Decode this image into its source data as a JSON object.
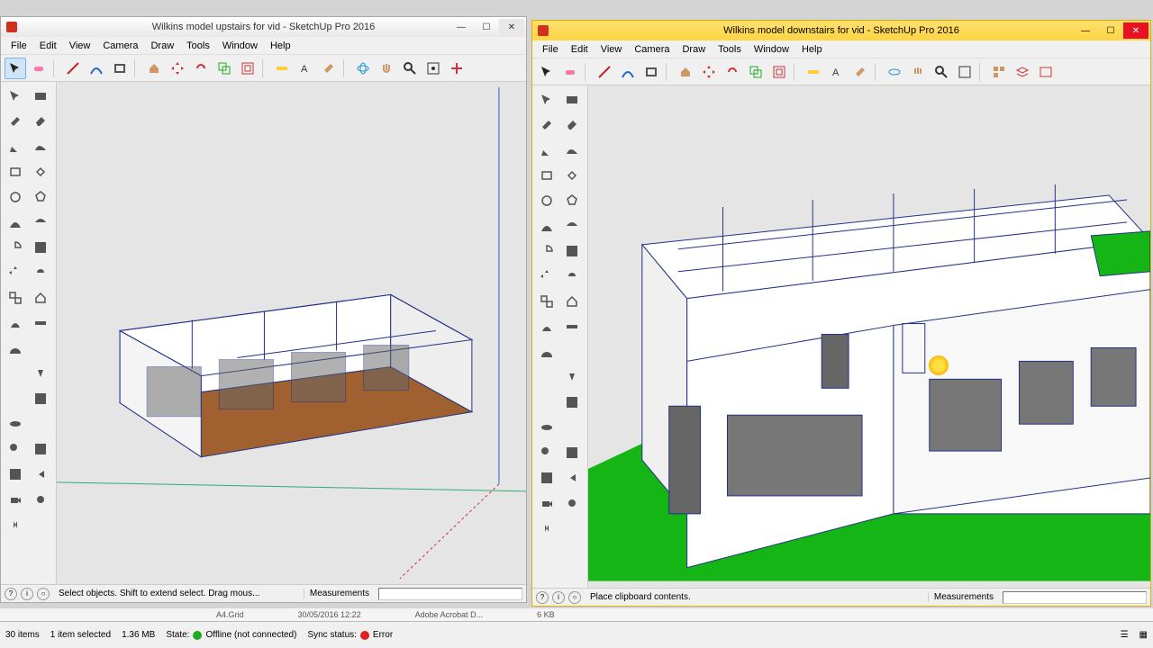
{
  "windows": {
    "left": {
      "title": "Wilkins model upstairs for vid - SketchUp Pro 2016",
      "status_hint": "Select objects. Shift to extend select. Drag mous...",
      "measurements_label": "Measurements"
    },
    "right": {
      "title": "Wilkins model downstairs for vid - SketchUp Pro 2016",
      "status_hint": "Place clipboard contents.",
      "measurements_label": "Measurements"
    }
  },
  "menus": [
    "File",
    "Edit",
    "View",
    "Camera",
    "Draw",
    "Tools",
    "Window",
    "Help"
  ],
  "win_buttons": {
    "min": "—",
    "max": "☐",
    "close": "✕"
  },
  "h_tool_names": [
    "select",
    "eraser",
    "line",
    "arc",
    "rectangle",
    "push-pull",
    "move",
    "rotate",
    "scale",
    "offset",
    "tape",
    "text",
    "dimension",
    "paint",
    "orbit",
    "pan",
    "zoom",
    "zoom-extents",
    "section"
  ],
  "v_tool_names": [
    "select",
    "make-component",
    "paint",
    "eraser",
    "pencil",
    "freehand",
    "rectangle",
    "rotated-rect",
    "circle",
    "polygon",
    "arc",
    "2pt-arc",
    "pie",
    "offset",
    "move",
    "rotate",
    "scale",
    "push-pull",
    "follow-me",
    "tape",
    "protractor",
    "dimension",
    "text",
    "3d-text",
    "axes",
    "section",
    "orbit",
    "pan",
    "zoom",
    "zoom-window",
    "zoom-extents",
    "prev-view",
    "position-camera",
    "look-around",
    "walk"
  ],
  "peek": {
    "a": "A4.Grid",
    "b": "30/05/2016 12:22",
    "c": "Adobe Acrobat D...",
    "d": "6 KB"
  },
  "taskbar": {
    "items": "30 items",
    "selected": "1 item selected",
    "size": "1.36 MB",
    "state_label": "State:",
    "state_val": "Offline (not connected)",
    "sync_label": "Sync status:",
    "sync_val": "Error"
  }
}
